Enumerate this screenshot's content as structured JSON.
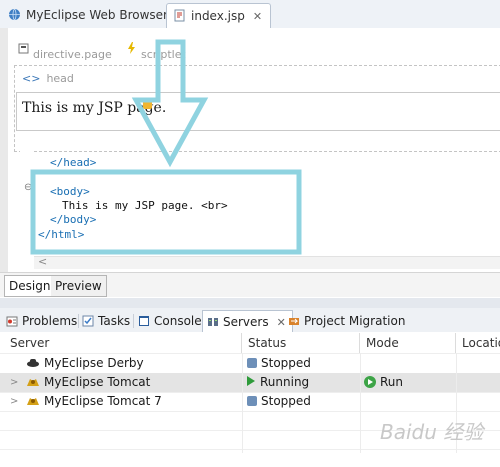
{
  "editor_tabs": [
    {
      "label": "MyEclipse Web Browser"
    },
    {
      "label": "index.jsp",
      "close": "✕"
    }
  ],
  "design": {
    "directive_label": "directive.page",
    "scriptlet_label": "scriptlet",
    "head_label": "head",
    "head_marker": "<>",
    "body_text": "This is my JSP page."
  },
  "source": {
    "lines": [
      "</head>",
      "<body>",
      "This is my JSP page. <br>",
      "</body>",
      "</html>"
    ],
    "fold_marker": "⊖",
    "scroll_marker": "<"
  },
  "mode_tabs": [
    "Design",
    "Preview"
  ],
  "view_tabs": [
    {
      "label": "Problems"
    },
    {
      "label": "Tasks"
    },
    {
      "label": "Console"
    },
    {
      "label": "Servers",
      "close": "✕"
    },
    {
      "label": "Project Migration"
    }
  ],
  "servers_table": {
    "columns": [
      "Server",
      "Status",
      "Mode",
      "Location"
    ],
    "rows": [
      {
        "name": "MyEclipse Derby",
        "status": "Stopped",
        "mode": "",
        "expander": ""
      },
      {
        "name": "MyEclipse Tomcat",
        "status": "Running",
        "mode": "Run",
        "expander": ">"
      },
      {
        "name": "MyEclipse Tomcat 7",
        "status": "Stopped",
        "mode": "",
        "expander": ">"
      }
    ]
  },
  "watermark": "Baidu 经验",
  "colors": {
    "annotation": "#8fd3e0",
    "tag": "#1a6fb3",
    "running": "#2e9b3a"
  },
  "icons": [
    "browser-globe-icon",
    "jsp-file-icon",
    "directive-icon",
    "scriptlet-icon",
    "problems-icon",
    "tasks-icon",
    "console-icon",
    "servers-icon",
    "migration-icon",
    "derby-icon",
    "tomcat-icon"
  ]
}
